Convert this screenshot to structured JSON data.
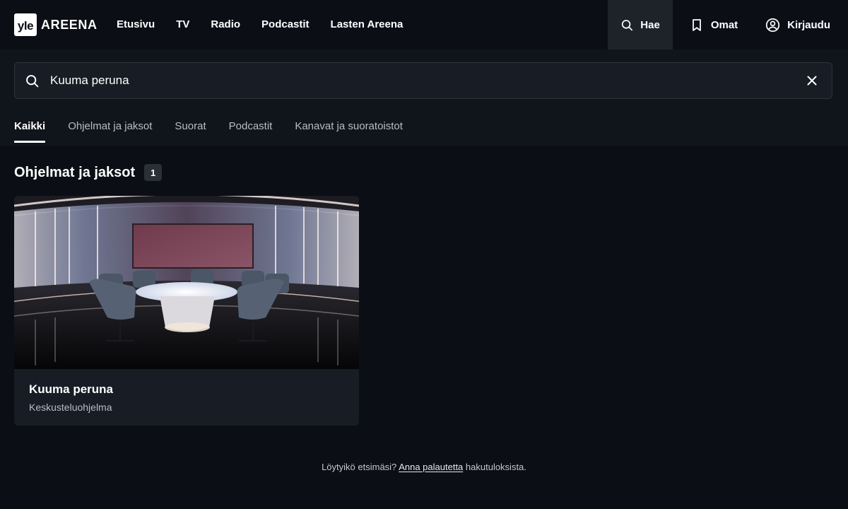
{
  "brand": {
    "logo_mark": "yle",
    "logo_word": "AREENA"
  },
  "nav": {
    "main": [
      "Etusivu",
      "TV",
      "Radio",
      "Podcastit",
      "Lasten Areena"
    ],
    "search_label": "Hae",
    "bookmarks_label": "Omat",
    "login_label": "Kirjaudu"
  },
  "search": {
    "value": "Kuuma peruna",
    "clear_icon": "close-icon"
  },
  "tabs": [
    {
      "label": "Kaikki",
      "active": true
    },
    {
      "label": "Ohjelmat ja jaksot",
      "active": false
    },
    {
      "label": "Suorat",
      "active": false
    },
    {
      "label": "Podcastit",
      "active": false
    },
    {
      "label": "Kanavat ja suoratoistot",
      "active": false
    }
  ],
  "results": {
    "section_title": "Ohjelmat ja jaksot",
    "count": "1",
    "items": [
      {
        "title": "Kuuma peruna",
        "subtitle": "Keskusteluohjelma"
      }
    ]
  },
  "footer": {
    "prefix": "Löytyikö etsimäsi?",
    "link": "Anna palautetta",
    "suffix": "hakutuloksista."
  },
  "colors": {
    "background": "#0b0e15",
    "panel": "#10141b",
    "card": "#181c24",
    "active_nav": "#1e2229",
    "text": "#ffffff",
    "muted_text": "#b8bcc4"
  }
}
